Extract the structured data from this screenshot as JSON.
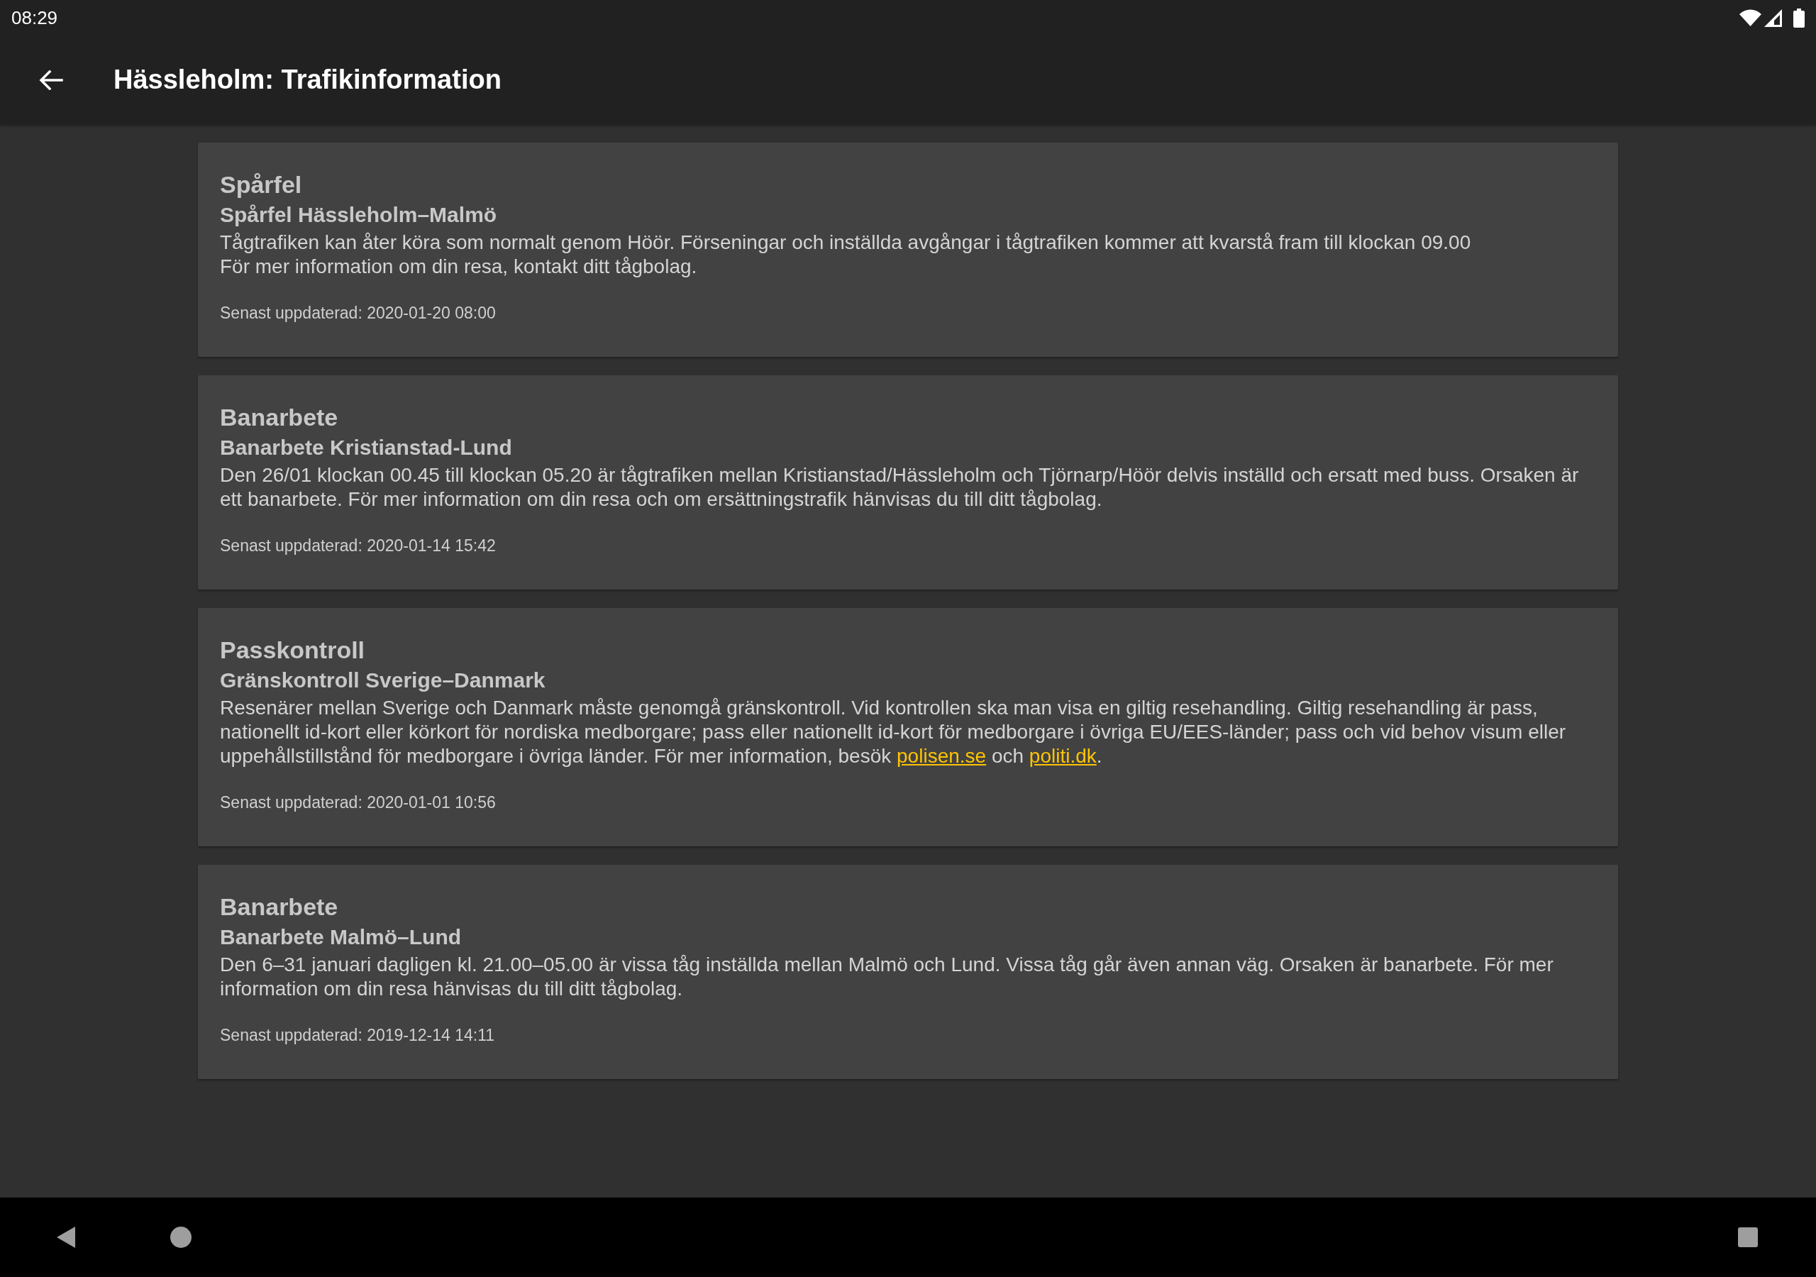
{
  "status_bar": {
    "time": "08:29"
  },
  "app_bar": {
    "title": "Hässleholm: Trafikinformation"
  },
  "messages": [
    {
      "category": "Spårfel",
      "title": "Spårfel Hässleholm–Malmö",
      "body": [
        {
          "kind": "text",
          "text": "Tågtrafiken kan åter köra som normalt genom Höör. Förseningar och inställda avgångar i tågtrafiken kommer att kvarstå fram till klockan 09.00\nFör mer information om din resa, kontakt ditt tågbolag."
        }
      ],
      "updated": "Senast uppdaterad: 2020-01-20 08:00"
    },
    {
      "category": "Banarbete",
      "title": "Banarbete Kristianstad-Lund",
      "body": [
        {
          "kind": "text",
          "text": "Den 26/01 klockan 00.45 till klockan 05.20 är tågtrafiken mellan Kristianstad/Hässleholm och Tjörnarp/Höör delvis inställd och ersatt med buss. Orsaken är ett banarbete. För mer information om din resa och om ersättningstrafik hänvisas du till ditt tågbolag."
        }
      ],
      "updated": "Senast uppdaterad: 2020-01-14 15:42"
    },
    {
      "category": "Passkontroll",
      "title": "Gränskontroll Sverige–Danmark",
      "body": [
        {
          "kind": "text",
          "text": "Resenärer mellan Sverige och Danmark måste genomgå gränskontroll. Vid kontrollen ska man visa en giltig resehandling. Giltig resehandling är pass, nationellt id-kort eller körkort för nordiska medborgare; pass eller nationellt id-kort för medborgare i övriga EU/EES-länder; pass och vid behov visum eller uppehållstillstånd för medborgare i övriga länder. För mer information, besök "
        },
        {
          "kind": "link",
          "text": "polisen.se"
        },
        {
          "kind": "text",
          "text": " och "
        },
        {
          "kind": "link",
          "text": "politi.dk"
        },
        {
          "kind": "text",
          "text": "."
        }
      ],
      "updated": "Senast uppdaterad: 2020-01-01 10:56"
    },
    {
      "category": "Banarbete",
      "title": "Banarbete Malmö–Lund",
      "body": [
        {
          "kind": "text",
          "text": "Den 6–31 januari dagligen kl. 21.00–05.00 är vissa tåg inställda mellan Malmö och Lund. Vissa tåg går även annan väg. Orsaken är banarbete. För mer information om din resa hänvisas du till ditt tågbolag."
        }
      ],
      "updated": "Senast uppdaterad: 2019-12-14 14:11"
    }
  ]
}
